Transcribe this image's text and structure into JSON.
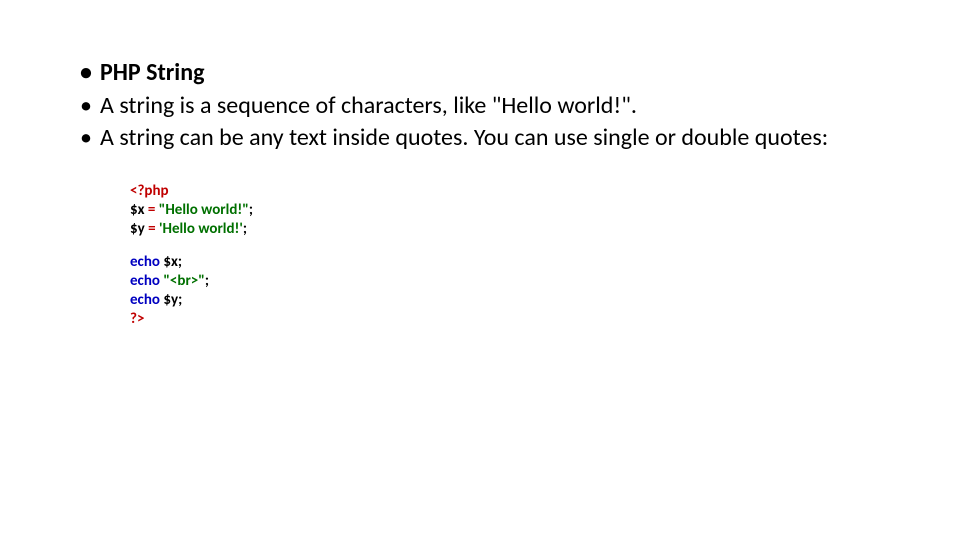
{
  "bullets": {
    "b1": "PHP String",
    "b2": "A string is a sequence of characters, like \"Hello world!\".",
    "b3": "A string can be any text inside quotes. You can use single or double quotes:"
  },
  "code": {
    "open_tag": "<?php",
    "l2a": "$x ",
    "l2b": "= ",
    "l2c": "\"Hello world!\"",
    "l2d": ";",
    "l3a": "$y ",
    "l3b": "= ",
    "l3c": "'Hello world!'",
    "l3d": ";",
    "l5a": "echo ",
    "l5b": "$x",
    "l5c": ";",
    "l6a": "echo ",
    "l6b": "\"<br>\"",
    "l6c": ";",
    "l7a": "echo ",
    "l7b": "$y",
    "l7c": ";",
    "close_tag": "?>"
  }
}
